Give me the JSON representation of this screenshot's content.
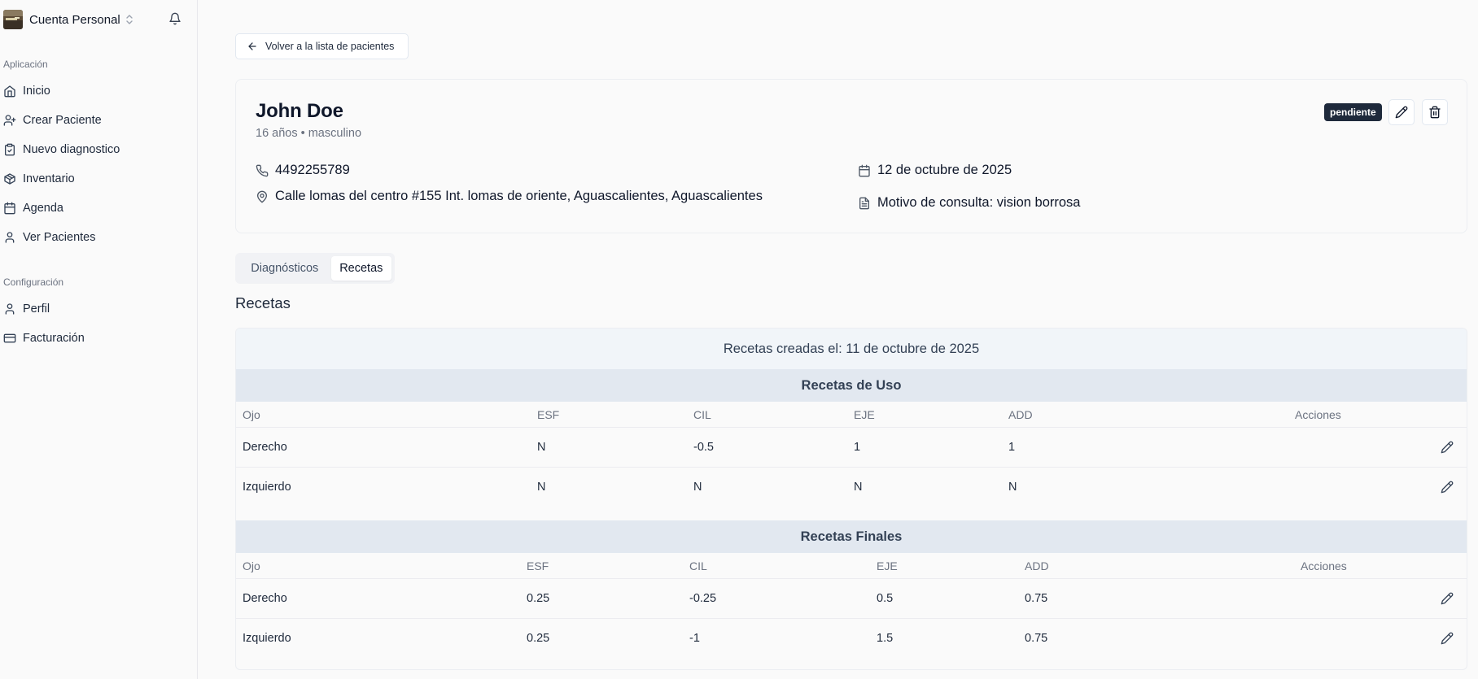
{
  "sidebar": {
    "account_name": "Cuenta Personal",
    "groups": [
      {
        "label": "Aplicación",
        "items": [
          {
            "label": "Inicio",
            "icon": "home-icon"
          },
          {
            "label": "Crear Paciente",
            "icon": "user-plus-icon"
          },
          {
            "label": "Nuevo diagnostico",
            "icon": "clipboard-check-icon"
          },
          {
            "label": "Inventario",
            "icon": "package-icon"
          },
          {
            "label": "Agenda",
            "icon": "calendar-icon"
          },
          {
            "label": "Ver Pacientes",
            "icon": "user-icon"
          }
        ]
      },
      {
        "label": "Configuración",
        "items": [
          {
            "label": "Perfil",
            "icon": "user-icon"
          },
          {
            "label": "Facturación",
            "icon": "credit-card-icon"
          }
        ]
      }
    ]
  },
  "back_label": "Volver a la lista de pacientes",
  "patient": {
    "name": "John Doe",
    "subtitle": "16 años • masculino",
    "status": "pendiente",
    "phone": "4492255789",
    "address": "Calle lomas del centro #155 Int. lomas de oriente, Aguascalientes, Aguascalientes",
    "date": "12 de octubre de 2025",
    "reason": "Motivo de consulta: vision borrosa"
  },
  "tabs": [
    "Diagnósticos",
    "Recetas"
  ],
  "active_tab": "Recetas",
  "section_title": "Recetas",
  "recetas": {
    "created_label": "Recetas creadas el:",
    "created_date": "11 de octubre de 2025",
    "columns": [
      "Ojo",
      "ESF",
      "CIL",
      "EJE",
      "ADD",
      "Acciones"
    ],
    "uso": {
      "title": "Recetas de Uso",
      "rows": [
        [
          "Derecho",
          "N",
          "-0.5",
          "1",
          "1"
        ],
        [
          "Izquierdo",
          "N",
          "N",
          "N",
          "N"
        ]
      ]
    },
    "finales": {
      "title": "Recetas Finales",
      "rows": [
        [
          "Derecho",
          "0.25",
          "-0.25",
          "0.5",
          "0.75"
        ],
        [
          "Izquierdo",
          "0.25",
          "-1",
          "1.5",
          "0.75"
        ]
      ]
    }
  }
}
